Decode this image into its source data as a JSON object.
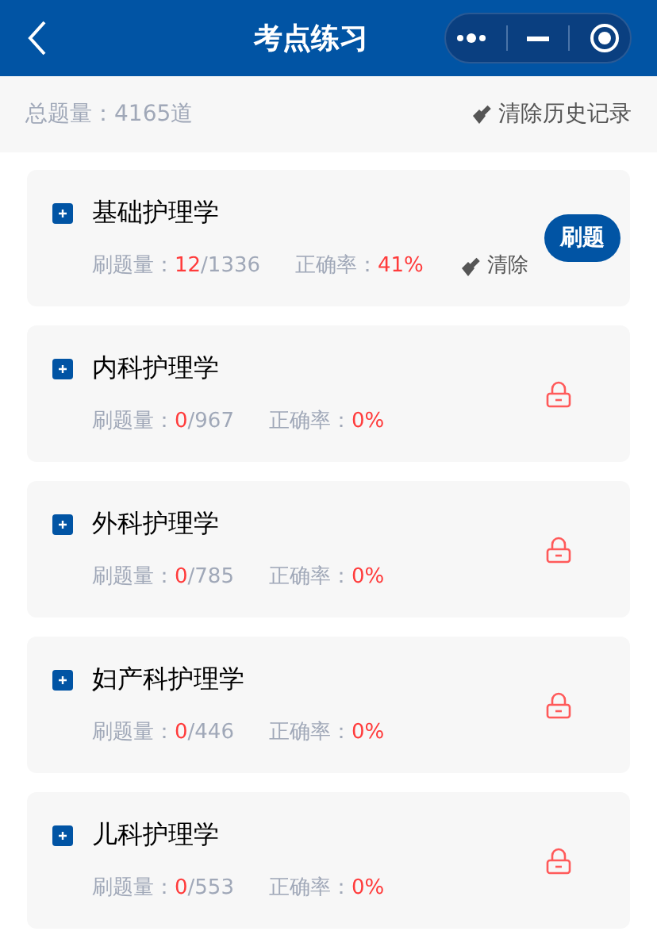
{
  "header": {
    "title": "考点练习"
  },
  "summary": {
    "total": "总题量：4165道",
    "clear_all": "清除历史记录"
  },
  "subjects": [
    {
      "name": "基础护理学",
      "done_label": "刷题量：",
      "done": "12",
      "total": "/1336",
      "accuracy_label": "正确率：",
      "accuracy": "41%",
      "locked": false,
      "clear_label": "清除",
      "action": "刷题"
    },
    {
      "name": "内科护理学",
      "done_label": "刷题量：",
      "done": "0",
      "total": "/967",
      "accuracy_label": "正确率：",
      "accuracy": "0%",
      "locked": true
    },
    {
      "name": "外科护理学",
      "done_label": "刷题量：",
      "done": "0",
      "total": "/785",
      "accuracy_label": "正确率：",
      "accuracy": "0%",
      "locked": true
    },
    {
      "name": "妇产科护理学",
      "done_label": "刷题量：",
      "done": "0",
      "total": "/446",
      "accuracy_label": "正确率：",
      "accuracy": "0%",
      "locked": true
    },
    {
      "name": "儿科护理学",
      "done_label": "刷题量：",
      "done": "0",
      "total": "/553",
      "accuracy_label": "正确率：",
      "accuracy": "0%",
      "locked": true
    }
  ]
}
